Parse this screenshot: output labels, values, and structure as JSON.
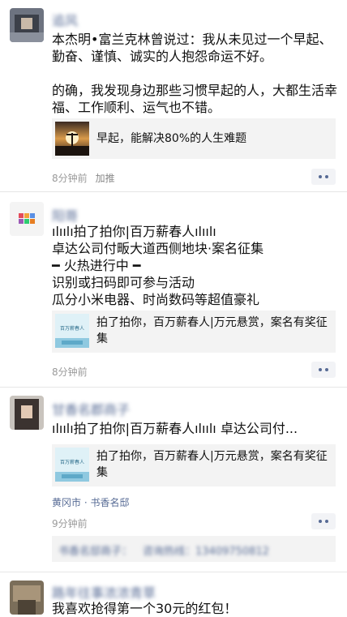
{
  "posts": [
    {
      "author": "追风",
      "text": "本杰明•富兰克林曾说过：我从未见过一个早起、勤奋、谨慎、诚实的人抱怨命运不好。\n\n的确，我发现身边那些习惯早起的人，大都生活幸福、工作顺利、运气也不错。",
      "card_title": "早起，能解决80%的人生难题",
      "time": "8分钟前",
      "extra": "加推"
    },
    {
      "author": "阳哥",
      "text": "ılıılı拍了拍你|百万薪春人ılıılı\n卓达公司付畈大道西侧地块·案名征集\n━ 火热进行中 ━\n识别或扫码即可参与活动\n瓜分小米电器、时尚数码等超值豪礼",
      "card_title": "拍了拍你，百万薪春人|万元悬赏，案名有奖征集",
      "card_thumb_text": "百万薪春人",
      "time": "8分钟前"
    },
    {
      "author": "甘香名郡商子",
      "text": "ılıılı拍了拍你|百万薪春人ılıılı 卓达公司付...",
      "card_title": "拍了拍你，百万薪春人|万元悬赏，案名有奖征集",
      "card_thumb_text": "百万薪春人",
      "location": "黄冈市 · 书香名邸",
      "time": "9分钟前",
      "comment_name": "书香名邸商子：",
      "comment_text": "咨询热线：13409750812"
    },
    {
      "author": "路年往事浓浓青草",
      "text": "我喜欢抢得第一个30元的红包！"
    }
  ]
}
